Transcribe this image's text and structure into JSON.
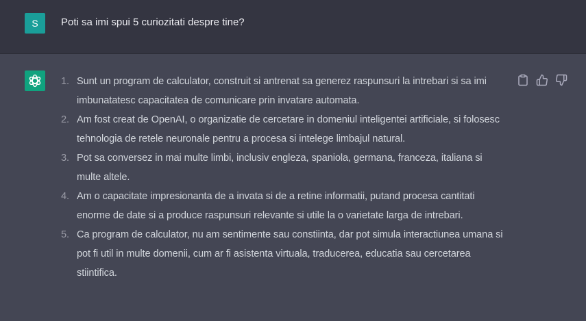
{
  "user_message": {
    "avatar_letter": "S",
    "text": "Poti sa imi spui 5 curiozitati despre tine?"
  },
  "assistant_message": {
    "avatar_icon": "openai-logo-icon",
    "items": [
      {
        "number": "1.",
        "text": "Sunt un program de calculator, construit si antrenat sa generez raspunsuri la intrebari si sa imi imbunatatesc capacitatea de comunicare prin invatare automata."
      },
      {
        "number": "2.",
        "text": "Am fost creat de OpenAI, o organizatie de cercetare in domeniul inteligentei artificiale, si folosesc tehnologia de retele neuronale pentru a procesa si intelege limbajul natural."
      },
      {
        "number": "3.",
        "text": "Pot sa conversez in mai multe limbi, inclusiv engleza, spaniola, germana, franceza, italiana si multe altele."
      },
      {
        "number": "4.",
        "text": "Am o capacitate impresionanta de a invata si de a retine informatii, putand procesa cantitati enorme de date si a produce raspunsuri relevante si utile la o varietate larga de intrebari."
      },
      {
        "number": "5.",
        "text": "Ca program de calculator, nu am sentimente sau constiinta, dar pot simula interactiunea umana si pot fi util in multe domenii, cum ar fi asistenta virtuala, traducerea, educatia sau cercetarea stiintifica."
      }
    ]
  },
  "action_icons": [
    "clipboard-icon",
    "thumbs-up-icon",
    "thumbs-down-icon"
  ],
  "colors": {
    "user_background": "#343541",
    "assistant_background": "#444654",
    "user_avatar": "#1a9e99",
    "bot_avatar": "#10a37f",
    "text": "#d1d5db",
    "list_number": "#9a9ba6"
  }
}
